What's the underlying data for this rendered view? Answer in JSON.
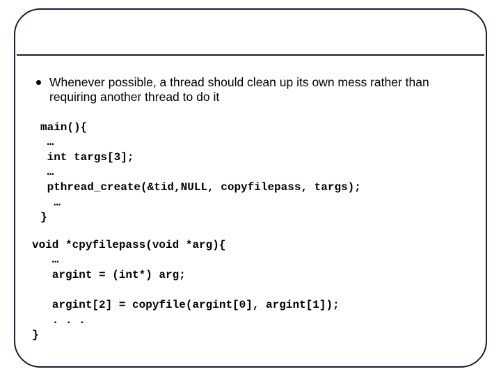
{
  "bullet": {
    "text": "Whenever possible, a thread should clean up its own mess rather than requiring another thread to do it"
  },
  "code_main": "main(){\n …\n int targs[3];\n …\n pthread_create(&tid,NULL, copyfilepass, targs);\n  …\n}",
  "code_func": "void *cpyfilepass(void *arg){\n   …\n   argint = (int*) arg;\n\n   argint[2] = copyfile(argint[0], argint[1]);\n   . . .\n}"
}
